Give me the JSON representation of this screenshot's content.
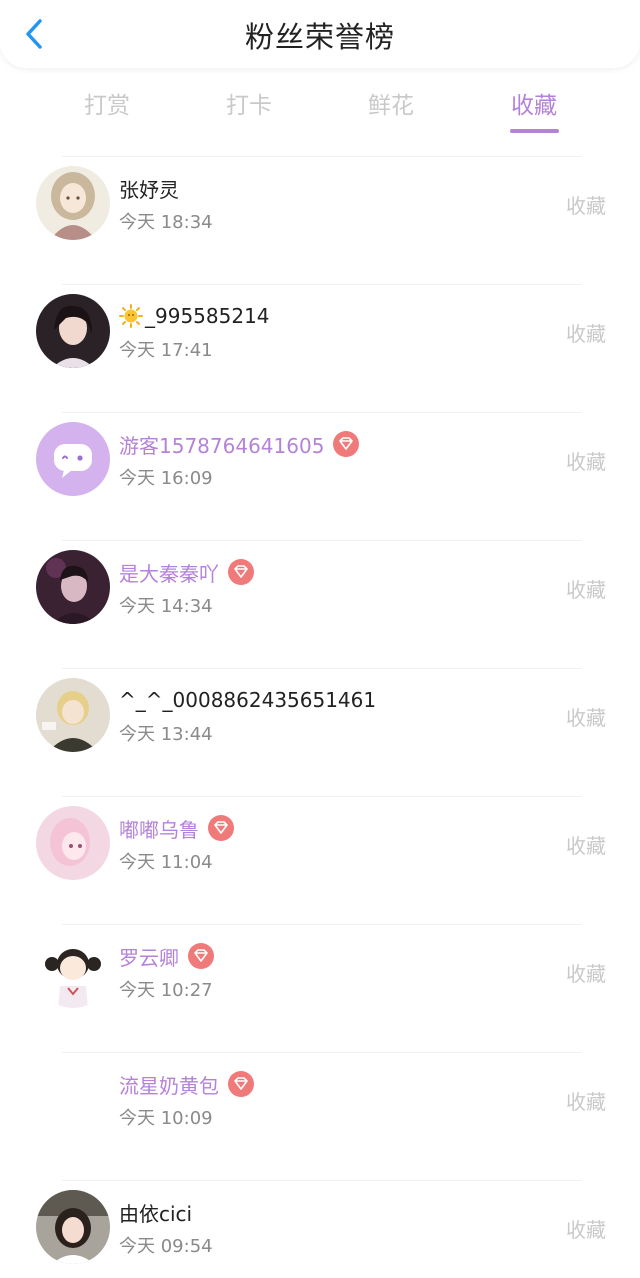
{
  "header": {
    "title": "粉丝荣誉榜",
    "back_icon": "chevron-left-icon"
  },
  "tabs": [
    {
      "label": "打赏",
      "active": false
    },
    {
      "label": "打卡",
      "active": false
    },
    {
      "label": "鲜花",
      "active": false
    },
    {
      "label": "收藏",
      "active": true
    }
  ],
  "colors": {
    "accent": "#b483d9",
    "badge": "#f07a7a",
    "back": "#2196f3"
  },
  "fans": [
    {
      "name": "张妤灵",
      "time": "今天 18:34",
      "action": "收藏",
      "vip": false,
      "avatar": "anime-girl-avatar"
    },
    {
      "name": "_995585214",
      "prefix_icon": "sun-emoji-icon",
      "time": "今天 17:41",
      "action": "收藏",
      "vip": false,
      "avatar": "girl-photo-avatar"
    },
    {
      "name": "游客1578764641605",
      "time": "今天 16:09",
      "action": "收藏",
      "vip": true,
      "avatar": "chat-bubble-avatar"
    },
    {
      "name": "是大秦秦吖",
      "time": "今天 14:34",
      "action": "收藏",
      "vip": true,
      "avatar": "boy-photo-avatar"
    },
    {
      "name": "^_^_0008862435651461",
      "time": "今天 13:44",
      "action": "收藏",
      "vip": false,
      "avatar": "blonde-anime-avatar"
    },
    {
      "name": "嘟嘟乌鲁",
      "time": "今天 11:04",
      "action": "收藏",
      "vip": true,
      "avatar": "pink-anime-avatar"
    },
    {
      "name": "罗云卿",
      "time": "今天 10:27",
      "action": "收藏",
      "vip": true,
      "avatar": "cartoon-girl-avatar"
    },
    {
      "name": "流星奶黄包",
      "time": "今天 10:09",
      "action": "收藏",
      "vip": true,
      "avatar": "blank-avatar"
    },
    {
      "name": "由依cici",
      "time": "今天 09:54",
      "action": "收藏",
      "vip": false,
      "avatar": "girl-selfie-avatar"
    }
  ]
}
